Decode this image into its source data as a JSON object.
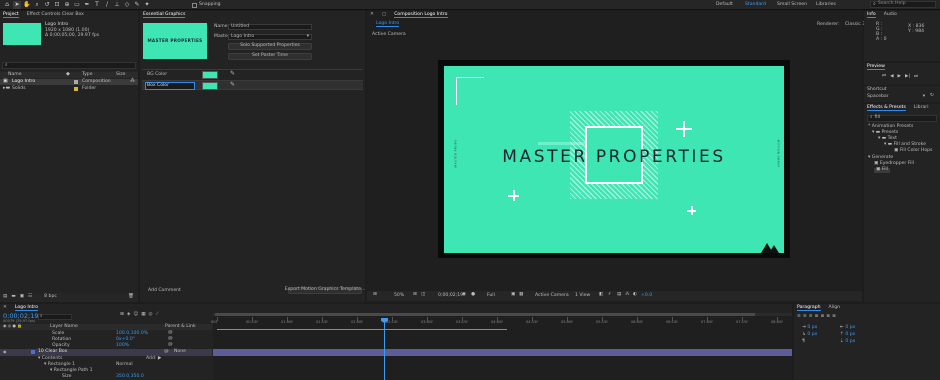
{
  "toolbar": {
    "snapping": "Snapping",
    "workspaces": [
      "Default",
      "Standard",
      "Small Screen",
      "Libraries"
    ],
    "active_workspace": "Standard",
    "search_placeholder": "Search Help"
  },
  "project": {
    "tabs": [
      "Project",
      "Effect Controls Clear Box"
    ],
    "comp_name": "Logo Intro",
    "comp_info": [
      "1920 x 1080 (1.00)",
      "Δ 0;00;05;00, 29.97 fps"
    ],
    "col_name": "Name",
    "col_type": "Type",
    "col_size": "Size",
    "items": [
      {
        "name": "Logo Intro",
        "type": "Composition"
      },
      {
        "name": "Solids",
        "type": "Folder"
      }
    ],
    "bpc": "8 bpc"
  },
  "essential_graphics": {
    "title": "Essential Graphics",
    "name_label": "Name",
    "name_value": "Untitled",
    "master_label": "Master",
    "master_value": "Logo Intro",
    "btn_solo": "Solo Supported Properties",
    "btn_poster": "Set Poster Time",
    "thumb_text": "MASTER PROPERTIES",
    "rows": [
      {
        "label": "BG Color",
        "color": "#3ee6b4"
      },
      {
        "label": "Box Color",
        "color": "#3ee6b4"
      }
    ],
    "add_comment": "Add Comment",
    "export_btn": "Export Motion Graphics Template..."
  },
  "composition": {
    "tab_label": "Composition Logo Intro",
    "sub_tab": "Logo Intro",
    "renderer_label": "Renderer:",
    "renderer_value": "Classic 3D",
    "active_camera": "Active Camera",
    "title_text": "MASTER PROPERTIES",
    "side_left": "MASTER PROPS",
    "side_right": "MOTION ARRAY",
    "bg_color": "#3ee6b4",
    "zoom": "50%",
    "timecode": "0;00;02;19",
    "resolution": "Full",
    "camera": "Active Camera",
    "view": "1 View",
    "exposure": "+0.0"
  },
  "info": {
    "tabs": [
      "Info",
      "Audio"
    ],
    "rgba": [
      "R :",
      "G :",
      "B :",
      "A : 0"
    ],
    "xy": [
      "X : 836",
      "Y : 984"
    ]
  },
  "preview": {
    "title": "Preview"
  },
  "shortcut": {
    "label": "Shortcut",
    "value": "Spacebar"
  },
  "effects": {
    "tabs": [
      "Effects & Presets",
      "Librari"
    ],
    "search_value": "fill",
    "tree": [
      "* Animation Presets",
      "Presets",
      "Text",
      "Fill and Stroke",
      "Fill Color Hops",
      "Generate",
      "Eyedropper Fill",
      "Fill"
    ]
  },
  "timeline": {
    "tab": "Logo Intro",
    "timecode": "0;00;02;19",
    "frames": "00079 (29.97 fps)",
    "col_layer": "Layer Name",
    "col_parent": "Parent & Link",
    "ticks": [
      "00f",
      "00:15f",
      "01:00f",
      "01:15f",
      "02:00f",
      "02:15f",
      "03:00f",
      "03:15f",
      "04:00f",
      "04:15f",
      "05:00f",
      "05:15f",
      "06:00f",
      "06:15f",
      "07:00f",
      "07:15f",
      "08:00f"
    ],
    "rows": [
      {
        "label": "Scale",
        "value": "100.0,100.0%"
      },
      {
        "label": "Rotation",
        "value": "0x+0.0°"
      },
      {
        "label": "Opacity",
        "value": "100%"
      },
      {
        "label": "10    Clear Box",
        "value": "",
        "parent": "None"
      },
      {
        "label": "Contents",
        "value": "",
        "add": "Add: ▶"
      },
      {
        "label": "Rectangle 1",
        "value": "Normal"
      },
      {
        "label": "Rectangle Path 1",
        "value": ""
      },
      {
        "label": "Size",
        "value": "350.0,350.0"
      }
    ]
  },
  "paragraph": {
    "tabs": [
      "Paragraph",
      "Align"
    ],
    "fields": [
      "0 px",
      "0 px",
      "0 px",
      "0 px",
      "0 px"
    ]
  }
}
